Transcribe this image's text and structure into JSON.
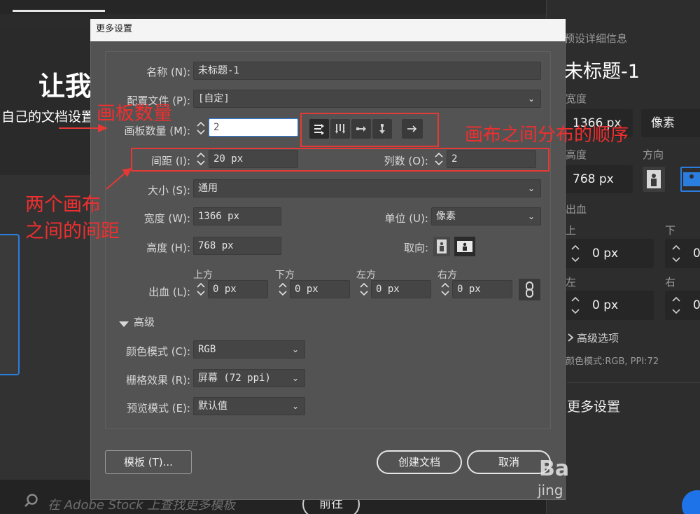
{
  "background": {
    "hero_title": "让我",
    "hero_subtitle": "自己的文档设置",
    "search_placeholder": "在 Adobe Stock 上查找更多模板",
    "go_button": "前往"
  },
  "right_panel": {
    "section_title": "预设详细信息",
    "preset_name": "未标题-1",
    "width_label": "宽度",
    "width_value": "1366 px",
    "unit_value": "像素",
    "height_label": "高度",
    "orientation_label": "方向",
    "height_value": "768 px",
    "bleed_label": "出血",
    "top_label": "上",
    "bottom_label": "下",
    "left_label": "左",
    "right_label": "右",
    "bleed_top": "0 px",
    "bleed_left": "0 px",
    "bleed_bottom_partial": "0",
    "bleed_right_partial": "0",
    "advanced_options": "高级选项",
    "color_info": "颜色模式:RGB, PPI:72",
    "more_settings": "更多设置"
  },
  "dialog": {
    "title": "更多设置",
    "name_label": "名称 (N):",
    "name_value": "未标题-1",
    "profile_label": "配置文件 (P):",
    "profile_value": "[自定]",
    "artboards_label": "画板数量 (M):",
    "artboards_value": "2",
    "spacing_label": "间距 (I):",
    "spacing_value": "20 px",
    "columns_label": "列数 (O):",
    "columns_value": "2",
    "size_label": "大小 (S):",
    "size_value": "通用",
    "width_label": "宽度 (W):",
    "width_value": "1366 px",
    "units_label": "单位 (U):",
    "units_value": "像素",
    "height_label": "高度 (H):",
    "height_value": "768 px",
    "orientation_label": "取向:",
    "bleed_label": "出血 (L):",
    "bleed_top_label": "上方",
    "bleed_bottom_label": "下方",
    "bleed_left_label": "左方",
    "bleed_right_label": "右方",
    "bleed_top": "0 px",
    "bleed_bottom": "0 px",
    "bleed_left": "0 px",
    "bleed_right": "0 px",
    "advanced_label": "高级",
    "color_mode_label": "颜色模式 (C):",
    "color_mode_value": "RGB",
    "raster_label": "栅格效果 (R):",
    "raster_value": "屏幕 (72 ppi)",
    "preview_label": "预览模式 (E):",
    "preview_value": "默认值",
    "templates_button": "模板 (T)...",
    "create_button": "创建文档",
    "cancel_button": "取消"
  },
  "annotations": {
    "artboard_count": "画板数量",
    "canvas_order": "画布之间分布的顺序",
    "spacing_line1": "两个画布",
    "spacing_line2": "之间的间距",
    "color": "#e53935"
  },
  "watermark": {
    "main": "Ba",
    "sub": "jing"
  },
  "colors": {
    "dialog_bg": "#535353",
    "field_bg": "#454545",
    "focus_blue": "#2f84e6",
    "accent_blue": "#2c7de0"
  }
}
